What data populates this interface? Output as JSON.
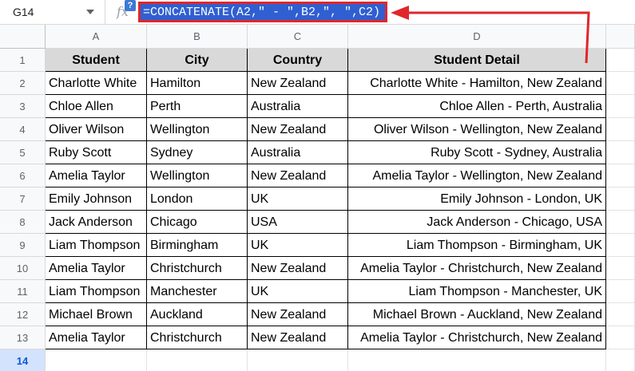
{
  "formula_bar": {
    "name_box": "G14",
    "fx_label": "fx",
    "help_label": "?",
    "formula": "=CONCATENATE(A2,\" - \",B2,\", \",C2)"
  },
  "sheet": {
    "columns": [
      "A",
      "B",
      "C",
      "D"
    ],
    "rows": [
      "1",
      "2",
      "3",
      "4",
      "5",
      "6",
      "7",
      "8",
      "9",
      "10",
      "11",
      "12",
      "13",
      "14"
    ],
    "selected_row": "14",
    "headers": [
      "Student",
      "City",
      "Country",
      "Student Detail"
    ],
    "data": [
      [
        "Charlotte White",
        "Hamilton",
        "New Zealand",
        "Charlotte White - Hamilton, New Zealand"
      ],
      [
        "Chloe Allen",
        "Perth",
        "Australia",
        "Chloe Allen - Perth, Australia"
      ],
      [
        "Oliver Wilson",
        "Wellington",
        "New Zealand",
        "Oliver Wilson - Wellington, New Zealand"
      ],
      [
        "Ruby Scott",
        "Sydney",
        "Australia",
        "Ruby Scott - Sydney, Australia"
      ],
      [
        "Amelia Taylor",
        "Wellington",
        "New Zealand",
        "Amelia Taylor - Wellington, New Zealand"
      ],
      [
        "Emily Johnson",
        "London",
        "UK",
        "Emily Johnson - London, UK"
      ],
      [
        "Jack Anderson",
        "Chicago",
        "USA",
        "Jack Anderson - Chicago, USA"
      ],
      [
        "Liam Thompson",
        "Birmingham",
        "UK",
        "Liam Thompson - Birmingham, UK"
      ],
      [
        "Amelia Taylor",
        "Christchurch",
        "New Zealand",
        "Amelia Taylor - Christchurch, New Zealand"
      ],
      [
        "Liam Thompson",
        "Manchester",
        "UK",
        "Liam Thompson - Manchester, UK"
      ],
      [
        "Michael Brown",
        "Auckland",
        "New Zealand",
        "Michael Brown - Auckland, New Zealand"
      ],
      [
        "Amelia Taylor",
        "Christchurch",
        "New Zealand",
        "Amelia Taylor - Christchurch, New Zealand"
      ]
    ]
  },
  "colors": {
    "annotation_red": "#e0262b",
    "formula_highlight": "#2f5fd1",
    "header_fill": "#d9d9d9",
    "selected_row_header": "#d3e3fd"
  }
}
